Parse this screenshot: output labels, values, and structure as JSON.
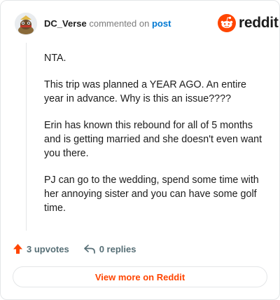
{
  "comment": {
    "username": "DC_Verse",
    "action_text": "commented on",
    "post_link": "post",
    "paragraphs": [
      "NTA.",
      "This trip was planned a YEAR AGO. An entire year in advance. Why is this an issue????",
      "Erin has known this rebound for all of 5 months and is getting married and she doesn't even want you there.",
      "PJ can go to the wedding, spend some time with her annoying sister and you can have some golf time."
    ]
  },
  "brand": {
    "name": "reddit",
    "color": "#ff4500"
  },
  "actions": {
    "upvotes": "3 upvotes",
    "replies": "0 replies"
  },
  "view_button": "View more on Reddit",
  "icons": {
    "upvote": "upvote-arrow-icon",
    "reply": "reply-arrow-icon",
    "logo": "reddit-snoo-icon"
  }
}
